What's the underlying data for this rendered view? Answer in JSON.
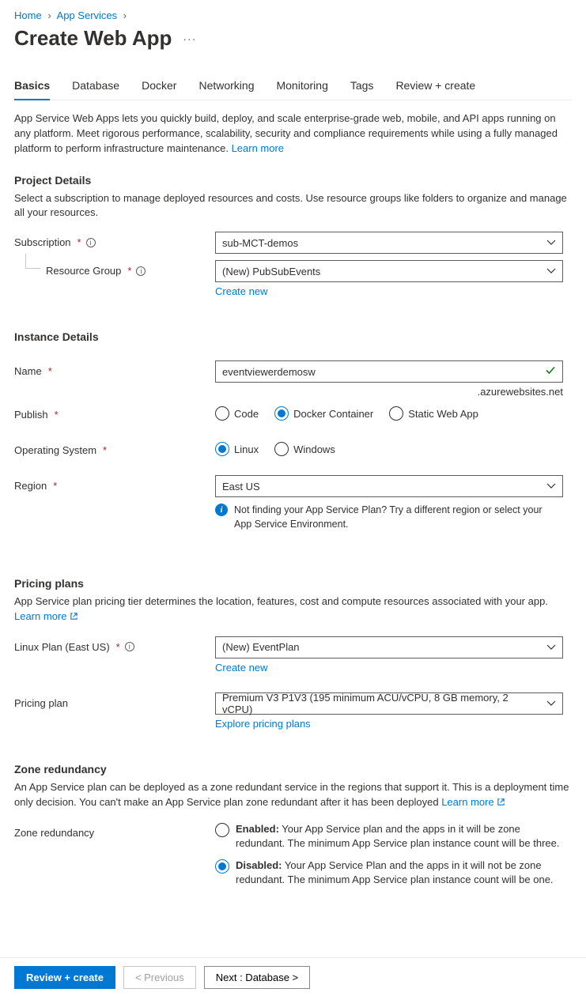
{
  "breadcrumb": {
    "home": "Home",
    "appServices": "App Services"
  },
  "title": "Create Web App",
  "tabs": {
    "basics": "Basics",
    "database": "Database",
    "docker": "Docker",
    "networking": "Networking",
    "monitoring": "Monitoring",
    "tags": "Tags",
    "review": "Review + create"
  },
  "intro": {
    "text": "App Service Web Apps lets you quickly build, deploy, and scale enterprise-grade web, mobile, and API apps running on any platform. Meet rigorous performance, scalability, security and compliance requirements while using a fully managed platform to perform infrastructure maintenance.  ",
    "learnMore": "Learn more"
  },
  "project": {
    "heading": "Project Details",
    "sub": "Select a subscription to manage deployed resources and costs. Use resource groups like folders to organize and manage all your resources.",
    "subscriptionLabel": "Subscription",
    "subscriptionValue": "sub-MCT-demos",
    "rgLabel": "Resource Group",
    "rgValue": "(New) PubSubEvents",
    "createNew": "Create new"
  },
  "instance": {
    "heading": "Instance Details",
    "nameLabel": "Name",
    "nameValue": "eventviewerdemosw",
    "domainSuffix": ".azurewebsites.net",
    "publishLabel": "Publish",
    "publishOptions": {
      "code": "Code",
      "docker": "Docker Container",
      "static": "Static Web App"
    },
    "osLabel": "Operating System",
    "osOptions": {
      "linux": "Linux",
      "windows": "Windows"
    },
    "regionLabel": "Region",
    "regionValue": "East US",
    "regionHint": "Not finding your App Service Plan? Try a different region or select your App Service Environment."
  },
  "pricing": {
    "heading": "Pricing plans",
    "sub": "App Service plan pricing tier determines the location, features, cost and compute resources associated with your app.",
    "learnMore": "Learn more",
    "planLabel": "Linux Plan (East US)",
    "planValue": "(New) EventPlan",
    "createNew": "Create new",
    "tierLabel": "Pricing plan",
    "tierValue": "Premium V3 P1V3 (195 minimum ACU/vCPU, 8 GB memory, 2 vCPU)",
    "explore": "Explore pricing plans"
  },
  "zone": {
    "heading": "Zone redundancy",
    "sub": "An App Service plan can be deployed as a zone redundant service in the regions that support it. This is a deployment time only decision. You can't make an App Service plan zone redundant after it has been deployed ",
    "learnMore": "Learn more",
    "rowLabel": "Zone redundancy",
    "enabled": {
      "title": "Enabled:",
      "text": " Your App Service plan and the apps in it will be zone redundant. The minimum App Service plan instance count will be three."
    },
    "disabled": {
      "title": "Disabled:",
      "text": " Your App Service Plan and the apps in it will not be zone redundant. The minimum App Service plan instance count will be one."
    }
  },
  "footer": {
    "review": "Review + create",
    "previous": "< Previous",
    "next": "Next : Database >"
  }
}
